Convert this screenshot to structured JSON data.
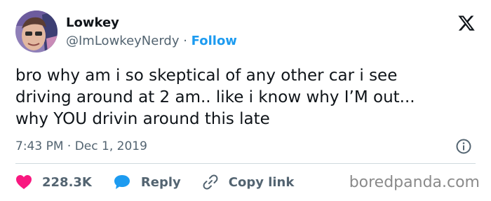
{
  "author": {
    "display_name": "Lowkey",
    "handle": "@ImLowkeyNerdy",
    "separator": " · ",
    "follow_label": "Follow"
  },
  "tweet": {
    "lines": [
      "bro why am i so skeptical of any other car i see",
      "driving around at 2 am.. like i know why I’M out...",
      "why YOU drivin around this late"
    ],
    "timestamp": "7:43 PM · Dec 1, 2019"
  },
  "actions": {
    "likes": "228.3K",
    "reply_label": "Reply",
    "copy_link_label": "Copy link"
  },
  "watermark": "boredpanda.com",
  "icons": {
    "logo": "x-logo-icon",
    "info": "info-icon",
    "like": "heart-icon",
    "reply": "speech-bubble-icon",
    "copy": "link-icon"
  },
  "colors": {
    "text": "#0f1419",
    "secondary": "#536471",
    "accent": "#1d9bf0",
    "like": "#f91880",
    "divider": "#cfd9de"
  }
}
